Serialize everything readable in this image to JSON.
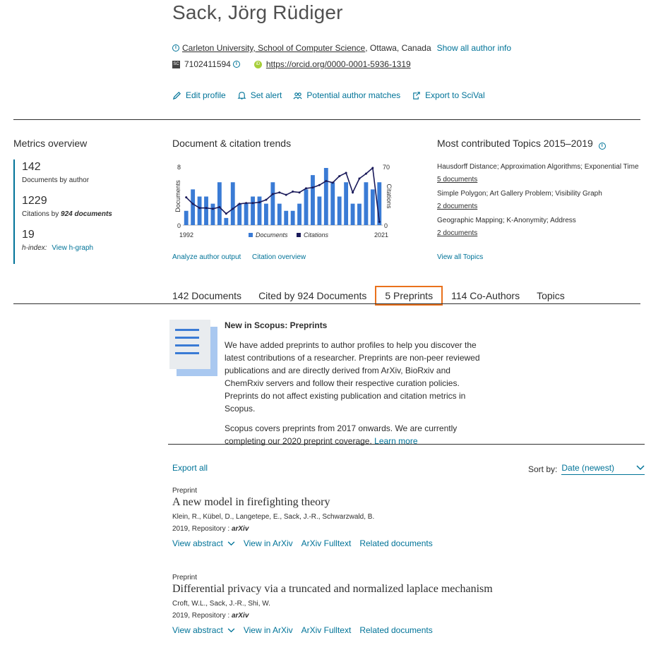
{
  "author": {
    "name": "Sack, Jörg Rüdiger",
    "affiliation_link": "Carleton University, School of Computer Science",
    "affiliation_rest": ", Ottawa, Canada",
    "show_info": "Show all author info",
    "scopus_id": "7102411594",
    "orcid": "https://orcid.org/0000-0001-5936-1319",
    "sc_badge": "SC",
    "orcid_badge": "iD"
  },
  "actions": {
    "edit_profile": "Edit profile",
    "set_alert": "Set alert",
    "potential_matches": "Potential author matches",
    "export_scival": "Export to SciVal"
  },
  "metrics": {
    "title": "Metrics overview",
    "documents_value": "142",
    "documents_label": "Documents by author",
    "citations_value": "1229",
    "citations_label_pre": "Citations by ",
    "citations_label_bold": "924 documents",
    "hindex_value": "19",
    "hindex_label": "h-index:",
    "hgraph_link": "View h-graph"
  },
  "trends": {
    "title": "Document & citation trends",
    "analyze_link": "Analyze author output",
    "citation_overview_link": "Citation overview"
  },
  "chart_data": {
    "type": "bar",
    "x": [
      1992,
      1993,
      1994,
      1995,
      1996,
      1997,
      1998,
      1999,
      2000,
      2001,
      2002,
      2003,
      2004,
      2005,
      2006,
      2007,
      2008,
      2009,
      2010,
      2011,
      2012,
      2013,
      2014,
      2015,
      2016,
      2017,
      2018,
      2019,
      2020,
      2021
    ],
    "x_tick_labels": [
      "1992",
      "2021"
    ],
    "series": [
      {
        "name": "Documents",
        "kind": "bar",
        "axis": "left",
        "values": [
          2,
          5,
          4,
          4,
          3,
          6,
          1,
          6,
          3,
          3,
          4,
          4,
          3,
          6,
          3,
          2,
          2,
          3,
          5,
          7,
          4,
          8,
          6,
          4,
          6,
          3,
          3,
          6,
          5,
          6
        ]
      },
      {
        "name": "Citations",
        "kind": "line",
        "axis": "right",
        "values": [
          34,
          26,
          21,
          21,
          20,
          22,
          14,
          20,
          26,
          27,
          27,
          28,
          31,
          38,
          40,
          37,
          41,
          40,
          45,
          46,
          49,
          54,
          52,
          60,
          64,
          40,
          57,
          63,
          70,
          4
        ]
      }
    ],
    "ylabel_left": "Documents",
    "ylabel_right": "Citations",
    "ylim_left": [
      0,
      8
    ],
    "ylim_right": [
      0,
      70
    ],
    "yticks_left": [
      "8",
      "0"
    ],
    "yticks_right": [
      "70",
      "0"
    ],
    "legend_placement": "bottom"
  },
  "topics": {
    "title": "Most contributed Topics 2015–2019",
    "items": [
      {
        "name": "Hausdorff Distance; Approximation Algorithms; Exponential Time",
        "docs": "5 documents"
      },
      {
        "name": "Simple Polygon; Art Gallery Problem; Visibility Graph",
        "docs": "2 documents"
      },
      {
        "name": "Geographic Mapping; K-Anonymity; Address",
        "docs": "2 documents"
      }
    ],
    "view_all": "View all Topics"
  },
  "tabs": [
    {
      "label": "142 Documents"
    },
    {
      "label": "Cited by 924 Documents"
    },
    {
      "label": "5 Preprints"
    },
    {
      "label": "114 Co-Authors"
    },
    {
      "label": "Topics"
    }
  ],
  "notice": {
    "title": "New in Scopus: Preprints",
    "p1": "We have added preprints to author profiles to help you discover the latest contributions of a researcher. Preprints are non-peer reviewed publications and are directly derived from ArXiv, BioRxiv and ChemRxiv servers and follow their respective curation policies. Preprints do not affect existing publication and citation metrics in Scopus.",
    "p2": "Scopus covers preprints from 2017 onwards. We are currently completing our 2020 preprint coverage.",
    "learn_more": "Learn more"
  },
  "results": {
    "export_all": "Export all",
    "sort_label": "Sort by:",
    "sort_value": "Date (newest)",
    "items": [
      {
        "type": "Preprint",
        "title": "A new model in firefighting theory",
        "authors": "Klein, R., Kübel, D., Langetepe, E., Sack, J.-R., Schwarzwald, B.",
        "source_pre": "2019, Repository : ",
        "source_repo": "arXiv",
        "links": [
          "View abstract",
          "View in ArXiv",
          "ArXiv Fulltext",
          "Related documents"
        ]
      },
      {
        "type": "Preprint",
        "title": "Differential privacy via a truncated and normalized laplace mechanism",
        "authors": "Croft, W.L., Sack, J.-R., Shi, W.",
        "source_pre": "2019, Repository : ",
        "source_repo": "arXiv",
        "links": [
          "View abstract",
          "View in ArXiv",
          "ArXiv Fulltext",
          "Related documents"
        ]
      }
    ]
  },
  "colors": {
    "link": "#007398",
    "bar": "#3a7bd5",
    "line": "#1a1a5a",
    "active_tab_border": "#e9711c"
  }
}
